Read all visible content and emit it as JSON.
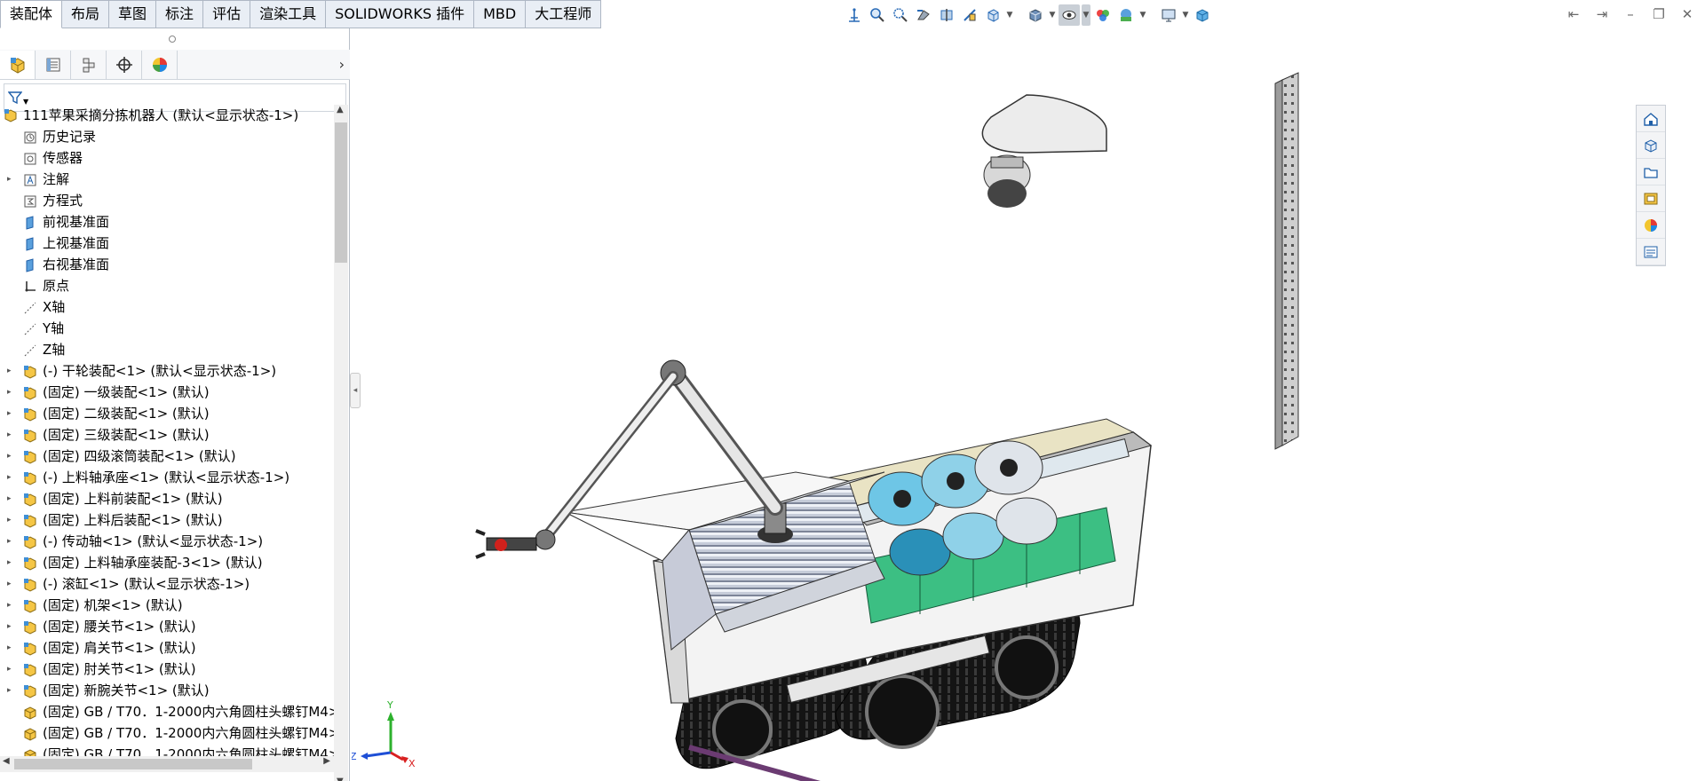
{
  "tabs": [
    {
      "label": "装配体",
      "active": true
    },
    {
      "label": "布局"
    },
    {
      "label": "草图"
    },
    {
      "label": "标注"
    },
    {
      "label": "评估"
    },
    {
      "label": "渲染工具"
    },
    {
      "label": "SOLIDWORKS 插件"
    },
    {
      "label": "MBD"
    },
    {
      "label": "大工程师"
    }
  ],
  "hud_icons": [
    "view-orient-icon",
    "zoom-fit-icon",
    "zoom-area-icon",
    "previous-view-icon",
    "section-view-icon",
    "dynamic-annotation-icon",
    "view-orientation-icon",
    "display-style-icon",
    "hide-show-icon",
    "edit-appearance-icon",
    "apply-scene-icon",
    "view-settings-icon",
    "3d-view-icon"
  ],
  "window_controls": [
    "restore-left-icon",
    "restore-right-icon",
    "minimize-icon",
    "restore-icon",
    "close-icon"
  ],
  "manager_tabs": [
    "featuremanager-icon",
    "propertymanager-icon",
    "configurationmanager-icon",
    "dimxpert-icon",
    "display-manager-icon"
  ],
  "tree": {
    "root": "111苹果采摘分拣机器人 (默认<显示状态-1>)",
    "items": [
      {
        "label": "历史记录",
        "icon": "history-icon",
        "expand": false
      },
      {
        "label": "传感器",
        "icon": "sensor-icon",
        "expand": false
      },
      {
        "label": "注解",
        "icon": "annotation-icon",
        "expand": true
      },
      {
        "label": "方程式",
        "icon": "equation-icon",
        "expand": false
      },
      {
        "label": "前视基准面",
        "icon": "plane-icon",
        "expand": false
      },
      {
        "label": "上视基准面",
        "icon": "plane-icon",
        "expand": false
      },
      {
        "label": "右视基准面",
        "icon": "plane-icon",
        "expand": false
      },
      {
        "label": "原点",
        "icon": "origin-icon",
        "expand": false
      },
      {
        "label": "X轴",
        "icon": "axis-icon",
        "expand": false
      },
      {
        "label": "Y轴",
        "icon": "axis-icon",
        "expand": false
      },
      {
        "label": "Z轴",
        "icon": "axis-icon",
        "expand": false
      },
      {
        "label": "(-) 干轮装配<1> (默认<显示状态-1>)",
        "icon": "subassembly-icon",
        "expand": true
      },
      {
        "label": "(固定) 一级装配<1> (默认)",
        "icon": "subassembly-icon",
        "expand": true
      },
      {
        "label": "(固定) 二级装配<1> (默认)",
        "icon": "subassembly-icon",
        "expand": true
      },
      {
        "label": "(固定) 三级装配<1> (默认)",
        "icon": "subassembly-icon",
        "expand": true
      },
      {
        "label": "(固定) 四级滚筒装配<1> (默认)",
        "icon": "subassembly-icon",
        "expand": true
      },
      {
        "label": "(-) 上料轴承座<1> (默认<显示状态-1>)",
        "icon": "subassembly-icon",
        "expand": true
      },
      {
        "label": "(固定) 上料前装配<1> (默认)",
        "icon": "subassembly-icon",
        "expand": true
      },
      {
        "label": "(固定) 上料后装配<1> (默认)",
        "icon": "subassembly-icon",
        "expand": true
      },
      {
        "label": "(-) 传动轴<1> (默认<显示状态-1>)",
        "icon": "subassembly-icon",
        "expand": true
      },
      {
        "label": "(固定) 上料轴承座装配-3<1> (默认)",
        "icon": "subassembly-icon",
        "expand": true
      },
      {
        "label": "(-) 滚缸<1> (默认<显示状态-1>)",
        "icon": "subassembly-icon",
        "expand": true
      },
      {
        "label": "(固定) 机架<1> (默认)",
        "icon": "subassembly-icon",
        "expand": true
      },
      {
        "label": "(固定) 腰关节<1> (默认)",
        "icon": "subassembly-icon",
        "expand": true
      },
      {
        "label": "(固定) 肩关节<1> (默认)",
        "icon": "subassembly-icon",
        "expand": true
      },
      {
        "label": "(固定) 肘关节<1> (默认)",
        "icon": "subassembly-icon",
        "expand": true
      },
      {
        "label": "(固定) 新腕关节<1> (默认)",
        "icon": "subassembly-icon",
        "expand": true
      },
      {
        "label": "(固定) GB / T70．1-2000内六角圆柱头螺钉M4>",
        "icon": "part-icon",
        "expand": false
      },
      {
        "label": "(固定) GB / T70．1-2000内六角圆柱头螺钉M4>",
        "icon": "part-icon",
        "expand": false
      },
      {
        "label": "(固定) GB / T70．1-2000内六角圆柱头螺钉M4>",
        "icon": "part-icon",
        "expand": false
      }
    ]
  },
  "triad": {
    "x": "X",
    "y": "Y",
    "z": "Z"
  },
  "task_pane": [
    "home-icon",
    "design-library-icon",
    "file-explorer-icon",
    "view-palette-icon",
    "appearances-icon",
    "custom-properties-icon"
  ]
}
